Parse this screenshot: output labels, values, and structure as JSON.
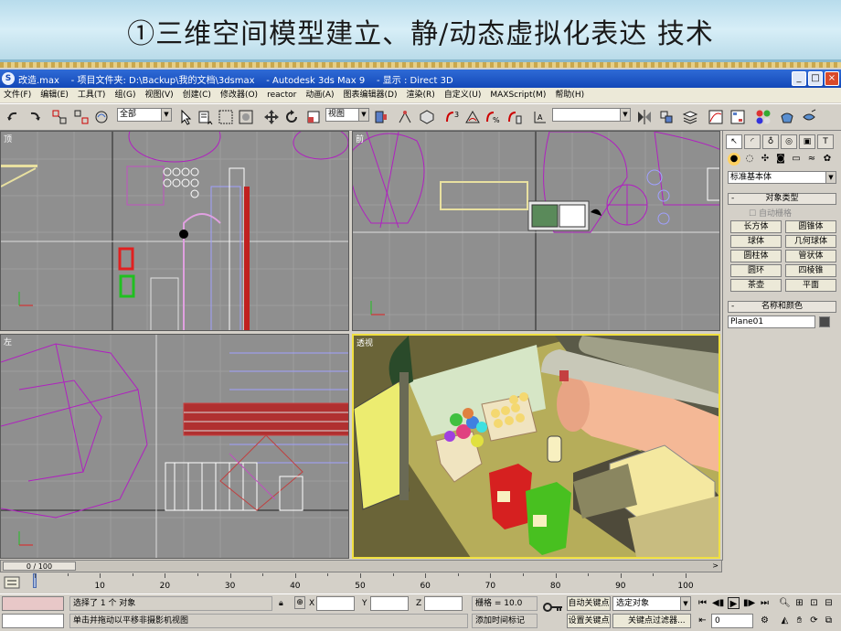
{
  "slide": {
    "title": "①三维空间模型建立、静/动态虚拟化表达 技术"
  },
  "window": {
    "title": "改造.max    - 项目文件夹: D:\\Backup\\我的文档\\3dsmax    - Autodesk 3ds Max 9    - 显示 : Direct 3D",
    "minimize": "_",
    "maximize": "□",
    "close": "×"
  },
  "menu": [
    "文件(F)",
    "编辑(E)",
    "工具(T)",
    "组(G)",
    "视图(V)",
    "创建(C)",
    "修改器(O)",
    "reactor",
    "动画(A)",
    "图表编辑器(D)",
    "渲染(R)",
    "自定义(U)",
    "MAXScript(M)",
    "帮助(H)"
  ],
  "toolbar": {
    "selection_filter": "全部",
    "reference_coord": "视图",
    "named_selection": "",
    "icons": [
      "undo-icon",
      "redo-icon",
      "select-link-icon",
      "unlink-icon",
      "bind-spacewarp-icon",
      "select-icon",
      "select-by-name-icon",
      "rect-region-icon",
      "window-crossing-icon",
      "move-icon",
      "rotate-icon",
      "scale-icon",
      "pivot-icon",
      "manipulate-icon",
      "snap-3d-icon",
      "angle-snap-icon",
      "percent-snap-icon",
      "spinner-snap-icon",
      "edit-named-sel-icon",
      "mirror-icon",
      "align-icon",
      "layer-icon",
      "curve-editor-icon",
      "schematic-icon",
      "material-editor-icon",
      "render-scene-icon",
      "quick-render-icon"
    ]
  },
  "viewports": {
    "top": {
      "label": "顶"
    },
    "front": {
      "label": "前"
    },
    "left": {
      "label": "左"
    },
    "perspective": {
      "label": "透视"
    }
  },
  "command_panel": {
    "tabs": [
      "create-tab",
      "modify-tab",
      "hierarchy-tab",
      "motion-tab",
      "display-tab",
      "utilities-tab"
    ],
    "category": "标准基本体",
    "object_type": {
      "title": "对象类型",
      "autogrid": "自动栅格",
      "buttons": [
        "长方体",
        "圆锥体",
        "球体",
        "几何球体",
        "圆柱体",
        "管状体",
        "圆环",
        "四棱锥",
        "茶壶",
        "平面"
      ]
    },
    "name_color": {
      "title": "名称和颜色",
      "name": "Plane01",
      "color": "#4a4a4a"
    }
  },
  "time": {
    "slider": "0 / 100",
    "ticks": [
      0,
      10,
      20,
      30,
      40,
      50,
      60,
      70,
      80,
      90,
      100
    ]
  },
  "status": {
    "selected": "选择了 1 个 对象",
    "prompt": "单击并拖动以平移非摄影机视图",
    "x_label": "X",
    "y_label": "Y",
    "z_label": "Z",
    "x_value": "",
    "y_value": "",
    "z_value": "",
    "grid": "栅格 = 10.0",
    "add_time_tag": "添加时间标记",
    "auto_key": "自动关键点",
    "set_key": "设置关键点",
    "selected_set": "选定对象",
    "key_filters": "关键点过滤器...",
    "frame": "0"
  }
}
